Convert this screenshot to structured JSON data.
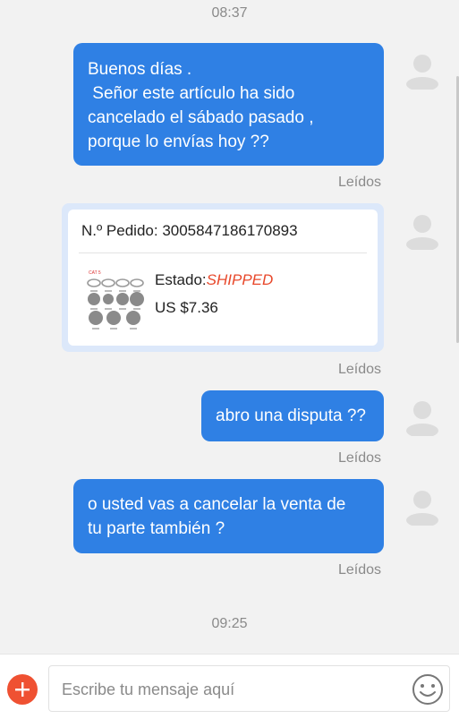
{
  "timestamps": {
    "top": "08:37",
    "bottom": "09:25"
  },
  "messages": [
    {
      "lines": [
        "Buenos días .",
        " Señor este artículo ha sido",
        "cancelado el sábado pasado ,",
        "porque lo envías hoy ??"
      ],
      "status": "Leídos"
    },
    {
      "lines": [
        "abro una disputa ??"
      ],
      "status": "Leídos"
    },
    {
      "lines": [
        "o usted vas a cancelar la venta de",
        "tu parte también ?"
      ],
      "status": "Leídos"
    }
  ],
  "order": {
    "number_text": "N.º Pedido: 3005847186170893",
    "status_label": "Estado:",
    "status_value": "SHIPPED",
    "price": "US $7.36",
    "read_status": "Leídos",
    "thumb_label": "CAT 5"
  },
  "icons": {
    "avatar": "user-avatar-icon",
    "add": "plus-icon",
    "emoji": "smiley-icon"
  },
  "composer": {
    "placeholder": "Escribe tu mensaje aquí",
    "value": ""
  },
  "colors": {
    "bubble": "#2f80e4",
    "accent": "#ef5132",
    "status_shipped": "#e8482b",
    "background": "#f2f2f2"
  }
}
